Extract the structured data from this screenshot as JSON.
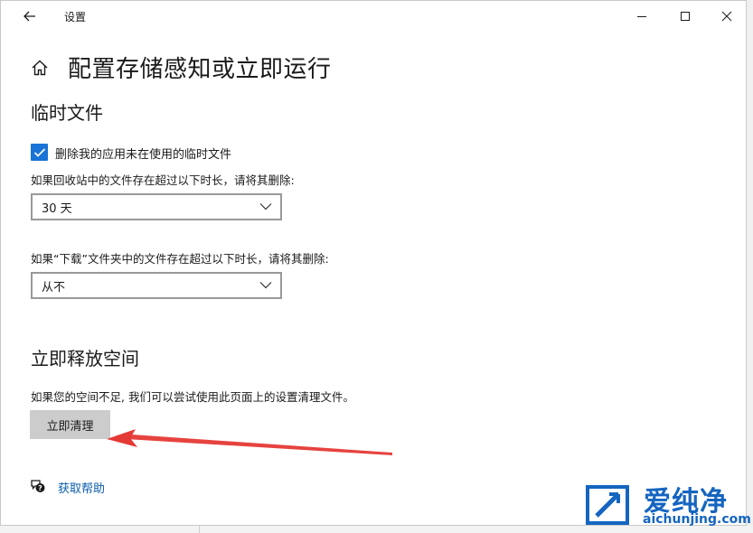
{
  "titlebar": {
    "title": "设置",
    "back_icon": "back-arrow-icon",
    "minimize_icon": "minimize-icon",
    "maximize_icon": "maximize-icon",
    "close_icon": "close-icon"
  },
  "header": {
    "home_icon": "home-icon",
    "page_title": "配置存储感知或立即运行"
  },
  "temp_files": {
    "section_title": "临时文件",
    "delete_checkbox": {
      "label": "删除我的应用未在使用的临时文件",
      "checked": true
    },
    "recycle_label": "如果回收站中的文件存在超过以下时长，请将其删除:",
    "recycle_select": {
      "value": "30 天"
    },
    "downloads_label": "如果“下载”文件夹中的文件存在超过以下时长，请将其删除:",
    "downloads_select": {
      "value": "从不"
    }
  },
  "free_space": {
    "section_title": "立即释放空间",
    "description": "如果您的空间不足, 我们可以尝试使用此页面上的设置清理文件。",
    "clean_button": "立即清理"
  },
  "help": {
    "icon": "help-chat-icon",
    "label": "获取帮助"
  },
  "watermark": {
    "title": "爱纯净",
    "domain": "aichunjing.com"
  },
  "colors": {
    "accent": "#1a73d6",
    "link": "#0b5cad",
    "button_bg": "#cccccc",
    "arrow": "#e53935",
    "watermark": "#1565c0"
  }
}
